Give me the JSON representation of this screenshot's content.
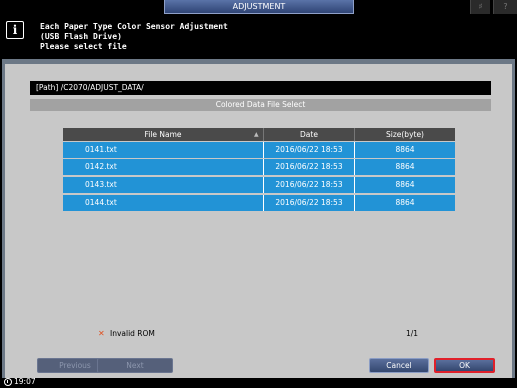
{
  "header": {
    "title": "ADJUSTMENT",
    "speaker_icon": "speaker-icon",
    "help_label": "?"
  },
  "message": {
    "lines": [
      "Each Paper Type Color Sensor Adjustment",
      "(USB Flash Drive)",
      "Please select file"
    ],
    "icon": "info-icon"
  },
  "dialog": {
    "path": "[Path] /C2070/ADJUST_DATA/",
    "subtitle": "Colored Data File Select",
    "table": {
      "columns": [
        "File Name",
        "Date",
        "Size(byte)"
      ],
      "sort_indicator": "▲",
      "rows": [
        {
          "name": "0141.txt",
          "date": "2016/06/22 18:53",
          "size": "8864"
        },
        {
          "name": "0142.txt",
          "date": "2016/06/22 18:53",
          "size": "8864"
        },
        {
          "name": "0143.txt",
          "date": "2016/06/22 18:53",
          "size": "8864"
        },
        {
          "name": "0144.txt",
          "date": "2016/06/22 18:53",
          "size": "8864"
        }
      ]
    },
    "invalid_label": "Invalid ROM",
    "page_count": "1/1"
  },
  "buttons": {
    "previous": "Previous",
    "next": "Next",
    "cancel": "Cancel",
    "ok": "OK"
  },
  "status": {
    "time": "19:07"
  },
  "colors": {
    "row_selected": "#2293d6",
    "ok_highlight": "#e0202a"
  }
}
